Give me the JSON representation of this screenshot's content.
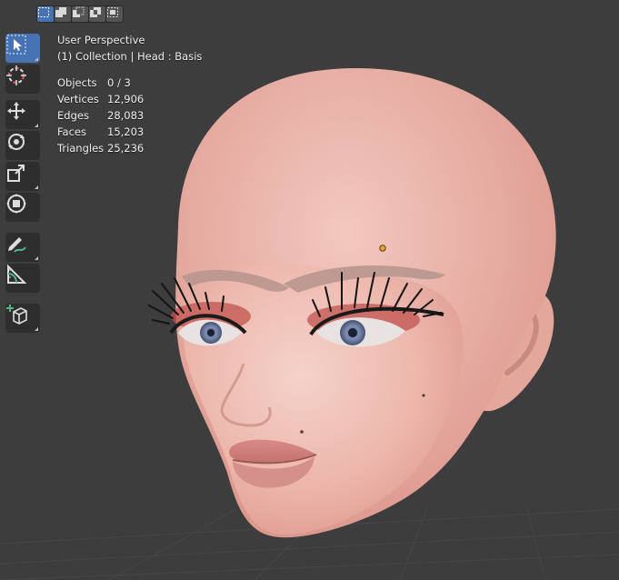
{
  "window": {
    "view_name": "User Perspective",
    "context_line": "(1) Collection | Head : Basis"
  },
  "selection_modes": [
    {
      "name": "set-new",
      "active": true
    },
    {
      "name": "extend",
      "active": false
    },
    {
      "name": "subtract",
      "active": false
    },
    {
      "name": "difference",
      "active": false
    },
    {
      "name": "intersect",
      "active": false
    }
  ],
  "toolbar": {
    "tools": [
      {
        "name": "select-box",
        "icon": "cursor-select-icon",
        "active": true
      },
      {
        "name": "cursor",
        "icon": "3d-cursor-icon",
        "active": false
      },
      {
        "name": "move",
        "icon": "move-arrows-icon",
        "active": false
      },
      {
        "name": "rotate",
        "icon": "rotate-icon",
        "active": false
      },
      {
        "name": "scale",
        "icon": "scale-icon",
        "active": false
      },
      {
        "name": "transform",
        "icon": "transform-icon",
        "active": false
      },
      {
        "name": "annotate",
        "icon": "annotate-pencil-icon",
        "active": false
      },
      {
        "name": "measure",
        "icon": "measure-ruler-icon",
        "active": false
      },
      {
        "name": "add-cube",
        "icon": "add-cube-icon",
        "active": false
      }
    ]
  },
  "stats": {
    "objects": {
      "label": "Objects",
      "value": "0 / 3"
    },
    "vertices": {
      "label": "Vertices",
      "value": "12,906"
    },
    "edges": {
      "label": "Edges",
      "value": "28,083"
    },
    "faces": {
      "label": "Faces",
      "value": "15,203"
    },
    "triangles": {
      "label": "Triangles",
      "value": "25,236"
    }
  },
  "colors": {
    "viewport_bg": "#3d3d3d",
    "accent": "#4772b3",
    "origin_dot": "#f0a030",
    "skin": "#eab0a6"
  }
}
